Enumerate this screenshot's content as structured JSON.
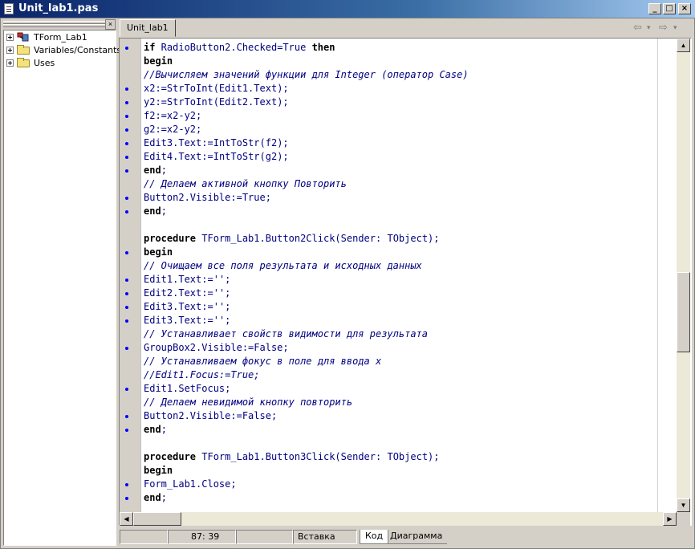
{
  "window": {
    "title": "Unit_lab1.pas",
    "buttons": {
      "min": "_",
      "max": "□",
      "close": "×"
    }
  },
  "tree": {
    "close": "×",
    "items": [
      {
        "label": "TForm_Lab1",
        "icon": "component-icon"
      },
      {
        "label": "Variables/Constants",
        "icon": "folder-icon"
      },
      {
        "label": "Uses",
        "icon": "folder-icon"
      }
    ]
  },
  "editor_tab": "Unit_lab1",
  "nav": {
    "back": "⇦",
    "back_drop": "▾",
    "forward": "⇨",
    "forward_drop": "▾"
  },
  "code_lines": [
    {
      "text": "if RadioButton2.Checked=True then",
      "dot": true
    },
    {
      "text": "begin",
      "dot": false
    },
    {
      "text": "//Вычисляем значений функции для Integer (оператор Case)",
      "dot": false
    },
    {
      "text": "x2:=StrToInt(Edit1.Text);",
      "dot": true
    },
    {
      "text": "y2:=StrToInt(Edit2.Text);",
      "dot": true
    },
    {
      "text": "f2:=x2-y2;",
      "dot": true
    },
    {
      "text": "g2:=x2-y2;",
      "dot": true
    },
    {
      "text": "Edit3.Text:=IntToStr(f2);",
      "dot": true
    },
    {
      "text": "Edit4.Text:=IntToStr(g2);",
      "dot": true
    },
    {
      "text": "end;",
      "dot": true
    },
    {
      "text": "// Делаем активной кнопку Повторить",
      "dot": false
    },
    {
      "text": "Button2.Visible:=True;",
      "dot": true
    },
    {
      "text": "end;",
      "dot": true
    },
    {
      "text": "",
      "dot": false
    },
    {
      "text": "procedure TForm_Lab1.Button2Click(Sender: TObject);",
      "dot": false
    },
    {
      "text": "begin",
      "dot": true
    },
    {
      "text": "// Очищаем все поля результата и исходных данных",
      "dot": false
    },
    {
      "text": "Edit1.Text:='';",
      "dot": true
    },
    {
      "text": "Edit2.Text:='';",
      "dot": true
    },
    {
      "text": "Edit3.Text:='';",
      "dot": true
    },
    {
      "text": "Edit3.Text:='';",
      "dot": true
    },
    {
      "text": "// Устанавливает свойств видимости для результата",
      "dot": false
    },
    {
      "text": "GroupBox2.Visible:=False;",
      "dot": true
    },
    {
      "text": "// Устанавливаем фокус в поле для ввода x",
      "dot": false
    },
    {
      "text": "//Edit1.Focus:=True;",
      "dot": false
    },
    {
      "text": "Edit1.SetFocus;",
      "dot": true
    },
    {
      "text": "// Делаем невидимой кнопку повторить",
      "dot": false
    },
    {
      "text": "Button2.Visible:=False;",
      "dot": true
    },
    {
      "text": "end;",
      "dot": true
    },
    {
      "text": "",
      "dot": false
    },
    {
      "text": "procedure TForm_Lab1.Button3Click(Sender: TObject);",
      "dot": false
    },
    {
      "text": "begin",
      "dot": false
    },
    {
      "text": "Form_Lab1.Close;",
      "dot": true
    },
    {
      "text": "end;",
      "dot": true
    }
  ],
  "scroll": {
    "up": "▲",
    "down": "▼",
    "left": "◀",
    "right": "▶",
    "vertical_position": 0.6
  },
  "status": {
    "position": "87:  39",
    "mode": "Вставка",
    "tab_code": "Код",
    "tab_diagram": "Диаграмма"
  }
}
